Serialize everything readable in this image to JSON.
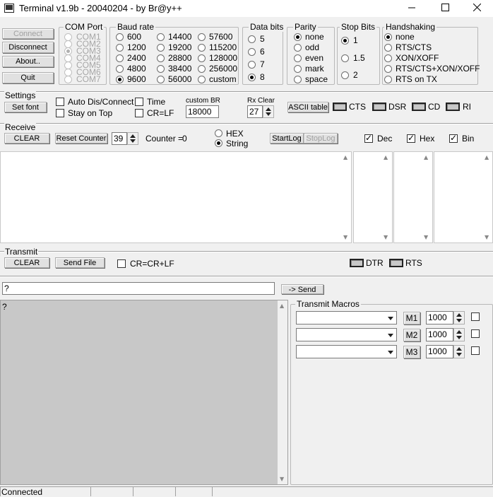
{
  "window": {
    "title": "Terminal v1.9b - 20040204 - by Br@y++"
  },
  "buttons": {
    "connect": "Connect",
    "disconnect": "Disconnect",
    "about": "About..",
    "quit": "Quit",
    "set_font": "Set font",
    "ascii_table": "ASCII table",
    "receive_clear": "CLEAR",
    "reset_counter": "Reset Counter",
    "start_log": "StartLog",
    "stop_log": "StopLog",
    "transmit_clear": "CLEAR",
    "send_file": "Send File",
    "send": "-> Send"
  },
  "com_port": {
    "title": "COM Port",
    "options": [
      "COM1",
      "COM2",
      "COM3",
      "COM4",
      "COM5",
      "COM6",
      "COM7"
    ],
    "selected": "COM3"
  },
  "baud_rate": {
    "title": "Baud rate",
    "options": [
      "600",
      "1200",
      "2400",
      "4800",
      "9600",
      "14400",
      "19200",
      "28800",
      "38400",
      "56000",
      "57600",
      "115200",
      "128000",
      "256000",
      "custom"
    ],
    "selected": "9600"
  },
  "data_bits": {
    "title": "Data bits",
    "options": [
      "5",
      "6",
      "7",
      "8"
    ],
    "selected": "8"
  },
  "parity": {
    "title": "Parity",
    "options": [
      "none",
      "odd",
      "even",
      "mark",
      "space"
    ],
    "selected": "none"
  },
  "stop_bits": {
    "title": "Stop Bits",
    "options": [
      "1",
      "1.5",
      "2"
    ],
    "selected": "1"
  },
  "handshaking": {
    "title": "Handshaking",
    "options": [
      "none",
      "RTS/CTS",
      "XON/XOFF",
      "RTS/CTS+XON/XOFF",
      "RTS on TX"
    ],
    "selected": "none"
  },
  "settings": {
    "title": "Settings",
    "auto_dis_connect": "Auto Dis/Connect",
    "stay_on_top": "Stay on Top",
    "time": "Time",
    "cr_lf": "CR=LF",
    "custom_br_label": "custom BR",
    "custom_br_value": "18000",
    "rx_clear_label": "Rx Clear",
    "rx_clear_value": "27"
  },
  "signals": {
    "cts": "CTS",
    "dsr": "DSR",
    "cd": "CD",
    "ri": "RI",
    "dtr": "DTR",
    "rts": "RTS"
  },
  "receive": {
    "title": "Receive",
    "counter_spin_value": "39",
    "counter_label": "Counter =",
    "counter_value": "0",
    "hex": "HEX",
    "string": "String",
    "mode_selected": "String",
    "dec": "Dec",
    "hex_check": "Hex",
    "bin": "Bin"
  },
  "transmit": {
    "title": "Transmit",
    "cr_crlf": "CR=CR+LF",
    "input_value": "?",
    "output_text": "?"
  },
  "macros": {
    "title": "Transmit Macros",
    "items": [
      {
        "label": "M1",
        "value": "1000"
      },
      {
        "label": "M2",
        "value": "1000"
      },
      {
        "label": "M3",
        "value": "1000"
      }
    ]
  },
  "status": {
    "text": "Connected"
  }
}
